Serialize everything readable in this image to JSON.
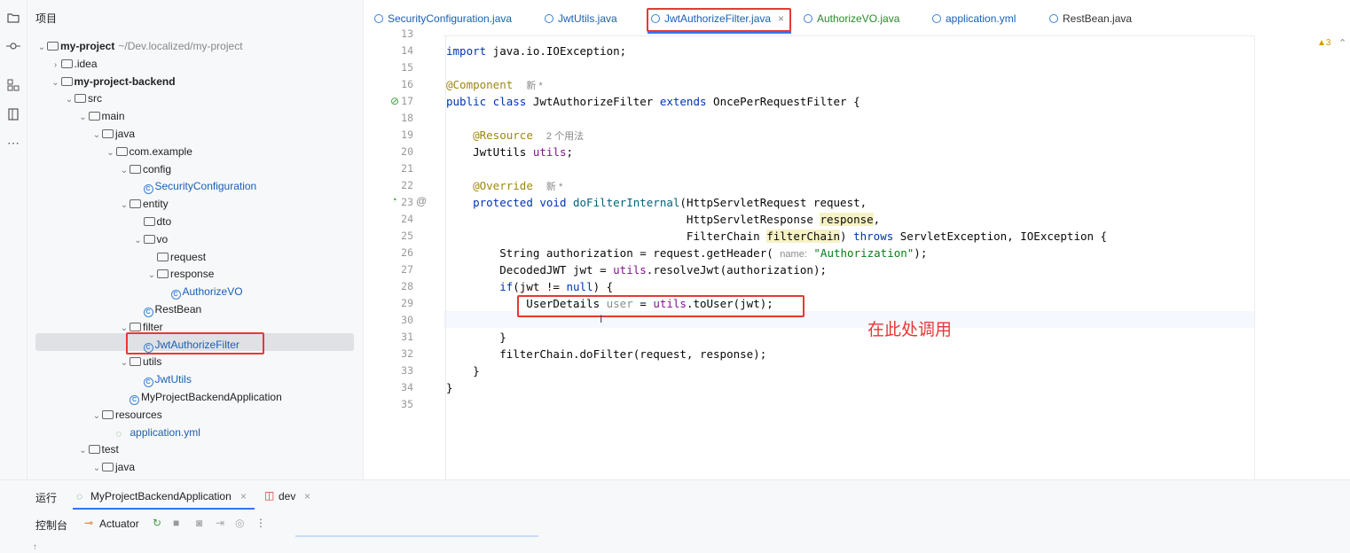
{
  "stripe": {
    "icons": [
      "folder-icon",
      "commit-icon",
      "structure-icon",
      "bookmarks-icon",
      "more-icon"
    ]
  },
  "project": {
    "title": "项目",
    "rows": [
      {
        "label": "my-project",
        "suffix": "~/Dev.localized/my-project",
        "indent": 0,
        "arrow": "⌄",
        "icon": "folder",
        "bold": true
      },
      {
        "label": ".idea",
        "indent": 1,
        "arrow": "›",
        "icon": "folder"
      },
      {
        "label": "my-project-backend",
        "indent": 1,
        "arrow": "⌄",
        "icon": "folder",
        "bold": true
      },
      {
        "label": "src",
        "indent": 2,
        "arrow": "⌄",
        "icon": "folder"
      },
      {
        "label": "main",
        "indent": 3,
        "arrow": "⌄",
        "icon": "folder"
      },
      {
        "label": "java",
        "indent": 4,
        "arrow": "⌄",
        "icon": "folder"
      },
      {
        "label": "com.example",
        "indent": 5,
        "arrow": "⌄",
        "icon": "folder"
      },
      {
        "label": "config",
        "indent": 6,
        "arrow": "⌄",
        "icon": "folder"
      },
      {
        "label": "SecurityConfiguration",
        "indent": 7,
        "arrow": "",
        "icon": "class",
        "blue": true
      },
      {
        "label": "entity",
        "indent": 6,
        "arrow": "⌄",
        "icon": "folder"
      },
      {
        "label": "dto",
        "indent": 7,
        "arrow": "",
        "icon": "folder"
      },
      {
        "label": "vo",
        "indent": 7,
        "arrow": "⌄",
        "icon": "folder"
      },
      {
        "label": "request",
        "indent": 8,
        "arrow": "",
        "icon": "folder"
      },
      {
        "label": "response",
        "indent": 8,
        "arrow": "⌄",
        "icon": "folder"
      },
      {
        "label": "AuthorizeVO",
        "indent": 9,
        "arrow": "",
        "icon": "class",
        "blue": true
      },
      {
        "label": "RestBean",
        "indent": 7,
        "arrow": "",
        "icon": "class"
      },
      {
        "label": "filter",
        "indent": 6,
        "arrow": "⌄",
        "icon": "folder"
      },
      {
        "label": "JwtAuthorizeFilter",
        "indent": 7,
        "arrow": "",
        "icon": "class",
        "blue": true,
        "selected": true
      },
      {
        "label": "utils",
        "indent": 6,
        "arrow": "⌄",
        "icon": "folder"
      },
      {
        "label": "JwtUtils",
        "indent": 7,
        "arrow": "",
        "icon": "class",
        "blue": true
      },
      {
        "label": "MyProjectBackendApplication",
        "indent": 6,
        "arrow": "",
        "icon": "class"
      },
      {
        "label": "resources",
        "indent": 4,
        "arrow": "⌄",
        "icon": "folder"
      },
      {
        "label": "application.yml",
        "indent": 5,
        "arrow": "",
        "icon": "yml",
        "blue": true
      },
      {
        "label": "test",
        "indent": 3,
        "arrow": "⌄",
        "icon": "folder"
      },
      {
        "label": "java",
        "indent": 4,
        "arrow": "⌄",
        "icon": "folder"
      }
    ]
  },
  "tabs": [
    {
      "label": "SecurityConfiguration.java",
      "color": "#1a5fb4"
    },
    {
      "label": "JwtUtils.java",
      "color": "#1a5fb4"
    },
    {
      "label": "JwtAuthorizeFilter.java",
      "color": "#1a5fb4",
      "active": true,
      "close": "×"
    },
    {
      "label": "AuthorizeVO.java",
      "color": "#2a8a2a"
    },
    {
      "label": "application.yml",
      "color": "#1a5fb4"
    },
    {
      "label": "RestBean.java",
      "color": "#333"
    }
  ],
  "warnings": "▲3",
  "line_numbers": [
    "13",
    "14",
    "15",
    "16",
    "17",
    "18",
    "19",
    "20",
    "21",
    "22",
    "23",
    "24",
    "25",
    "26",
    "27",
    "28",
    "29",
    "30",
    "31",
    "32",
    "33",
    "34",
    "35"
  ],
  "annotation_note": "在此处调用",
  "bottom": {
    "run_label": "运行",
    "run_tabs": [
      {
        "label": "MyProjectBackendApplication",
        "close": "×"
      },
      {
        "label": "dev",
        "close": "×"
      }
    ],
    "console_label": "控制台",
    "actuator_label": "Actuator"
  }
}
